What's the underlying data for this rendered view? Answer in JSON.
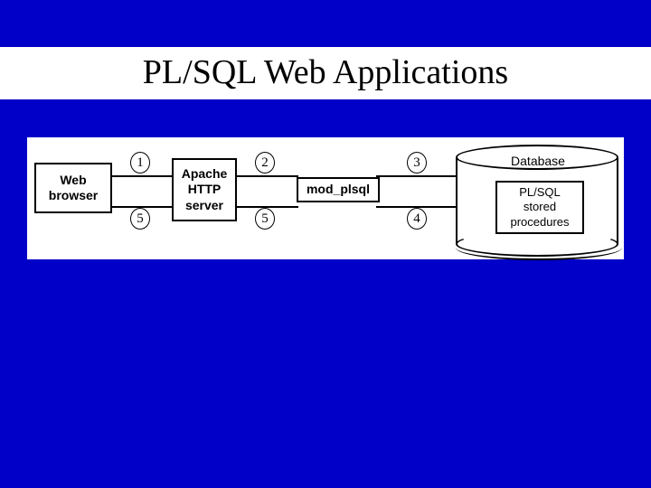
{
  "title": "PL/SQL Web Applications",
  "boxes": {
    "web_browser": "Web\nbrowser",
    "apache": "Apache\nHTTP\nserver",
    "mod_plsql": "mod_plsql"
  },
  "database": {
    "label": "Database",
    "stored_proc": "PL/SQL\nstored\nprocedures"
  },
  "steps": {
    "s1": "1",
    "s2": "2",
    "s3": "3",
    "s4": "4",
    "s5a": "5",
    "s5b": "5"
  },
  "chart_data": {
    "type": "diagram",
    "title": "PL/SQL Web Applications",
    "nodes": [
      {
        "id": "web_browser",
        "label": "Web browser"
      },
      {
        "id": "apache",
        "label": "Apache HTTP server"
      },
      {
        "id": "mod_plsql",
        "label": "mod_plsql"
      },
      {
        "id": "database",
        "label": "Database",
        "contains": [
          "plsql_stored_procedures"
        ]
      },
      {
        "id": "plsql_stored_procedures",
        "label": "PL/SQL stored procedures"
      }
    ],
    "edges": [
      {
        "from": "web_browser",
        "to": "apache",
        "step": 1
      },
      {
        "from": "apache",
        "to": "mod_plsql",
        "step": 2
      },
      {
        "from": "mod_plsql",
        "to": "database",
        "step": 3
      },
      {
        "from": "database",
        "to": "mod_plsql",
        "step": 4
      },
      {
        "from": "mod_plsql",
        "to": "apache",
        "step": 5
      },
      {
        "from": "apache",
        "to": "web_browser",
        "step": 5
      }
    ]
  }
}
